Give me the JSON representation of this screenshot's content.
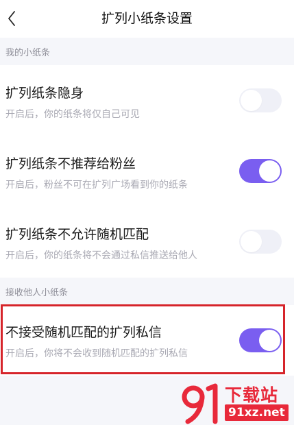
{
  "header": {
    "title": "扩列小纸条设置",
    "back_icon": "chevron-left-icon"
  },
  "sections": [
    {
      "label": "我的小纸条",
      "items": [
        {
          "title": "扩列纸条隐身",
          "description": "开启后，你的纸条将仅自己可见",
          "enabled": false
        },
        {
          "title": "扩列纸条不推荐给粉丝",
          "description": "开启后，粉丝不可在扩列广场看到你的纸条",
          "enabled": true
        },
        {
          "title": "扩列纸条不允许随机匹配",
          "description": "开启后，你的纸条将不会通过私信推送给他人",
          "enabled": false
        }
      ]
    },
    {
      "label": "接收他人小纸条",
      "items": [
        {
          "title": "不接受随机匹配的扩列私信",
          "description": "开启后，你将不会收到随机匹配的扩列私信",
          "enabled": true
        }
      ]
    }
  ],
  "watermark": {
    "title": "下载站",
    "url": "91xz.net",
    "mark": "91"
  },
  "colors": {
    "accent": "#7a5ef0",
    "toggle_off": "#eff0f7",
    "highlight": "#d6242a",
    "watermark": "#e8293a"
  }
}
